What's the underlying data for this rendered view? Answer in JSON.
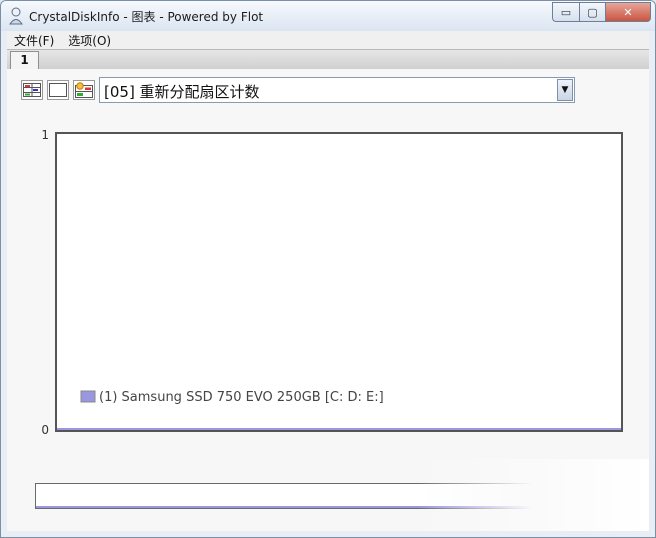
{
  "window": {
    "title": "CrystalDiskInfo - 图表 - Powered by Flot",
    "controls": {
      "minimize": "▭",
      "maximize": "▢",
      "close": "✕"
    }
  },
  "menu": {
    "items": [
      "文件(F)",
      "选项(O)"
    ]
  },
  "tabs": [
    {
      "label": "1",
      "selected": true
    }
  ],
  "toolbar": {
    "buttons": [
      {
        "name": "chart-all-icon"
      },
      {
        "name": "blank-chart-icon"
      },
      {
        "name": "chart-settings-icon"
      }
    ],
    "select": {
      "value": "[05] 重新分配扇区计数"
    }
  },
  "chart_data": {
    "type": "line",
    "title": "",
    "xlabel": "",
    "ylabel": "",
    "ylim": [
      0,
      1
    ],
    "y_ticks": [
      "1",
      "0"
    ],
    "series": [
      {
        "name": "(1) Samsung SSD 750 EVO 250GB [C: D: E:]",
        "color": "#9a96e0",
        "values": [
          0
        ]
      }
    ],
    "legend": "bottom-left",
    "grid": false
  }
}
